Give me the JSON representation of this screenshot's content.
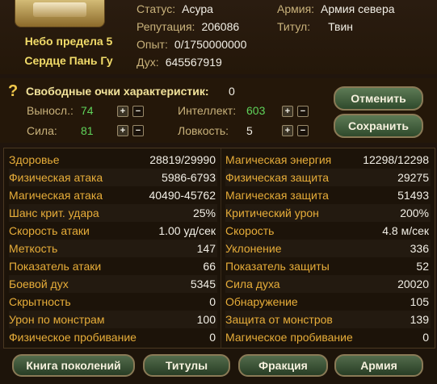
{
  "header": {
    "character_lines": [
      "Небо предела 5",
      "Сердце Пань Гу"
    ],
    "info_left": [
      {
        "label": "Статус:",
        "value": "Асура"
      },
      {
        "label": "Репутация:",
        "value": "206086"
      },
      {
        "label": "Опыт:",
        "value": "0/1750000000"
      },
      {
        "label": "Дух:",
        "value": "645567919"
      }
    ],
    "info_right": [
      {
        "label": "Армия:",
        "value": "Армия севера"
      },
      {
        "label": "Титул:",
        "value": "Твин"
      }
    ]
  },
  "points": {
    "title": "Свободные очки характеристик:",
    "free_points": "0",
    "attributes": [
      {
        "label": "Выносл.:",
        "value": "74"
      },
      {
        "label": "Интеллект:",
        "value": "603"
      },
      {
        "label": "Сила:",
        "value": "81"
      },
      {
        "label": "Ловкость:",
        "value": "5"
      }
    ],
    "plus_glyph": "+",
    "minus_glyph": "−",
    "buttons": {
      "cancel": "Отменить",
      "save": "Сохранить"
    }
  },
  "stats": {
    "left": [
      {
        "name": "Здоровье",
        "value": "28819/29990"
      },
      {
        "name": "Физическая атака",
        "value": "5986-6793"
      },
      {
        "name": "Магическая атака",
        "value": "40490-45762"
      },
      {
        "name": "Шанс крит. удара",
        "value": "25%"
      },
      {
        "name": "Скорость атаки",
        "value": "1.00 уд/сек"
      },
      {
        "name": "Меткость",
        "value": "147"
      },
      {
        "name": "Показатель атаки",
        "value": "66"
      },
      {
        "name": "Боевой дух",
        "value": "5345"
      },
      {
        "name": "Скрытность",
        "value": "0"
      },
      {
        "name": "Урон по монстрам",
        "value": "100"
      },
      {
        "name": "Физическое пробивание",
        "value": "0"
      }
    ],
    "right": [
      {
        "name": "Магическая энергия",
        "value": "12298/12298"
      },
      {
        "name": "Физическая защита",
        "value": "29275"
      },
      {
        "name": "Магическая защита",
        "value": "51493"
      },
      {
        "name": "Критический урон",
        "value": "200%"
      },
      {
        "name": "Скорость",
        "value": "4.8 м/сек"
      },
      {
        "name": "Уклонение",
        "value": "336"
      },
      {
        "name": "Показатель защиты",
        "value": "52"
      },
      {
        "name": "Сила духа",
        "value": "20020"
      },
      {
        "name": "Обнаружение",
        "value": "105"
      },
      {
        "name": "Защита от монстров",
        "value": "139"
      },
      {
        "name": "Магическое пробивание",
        "value": "0"
      }
    ]
  },
  "tabs": [
    "Книга поколений",
    "Титулы",
    "Фракция",
    "Армия"
  ],
  "icons": {
    "help": "question-mark-icon",
    "portrait": "character-portrait-icon"
  },
  "colors": {
    "stat_name": "#e7ad39",
    "attribute_value": "#5fd35a",
    "char_name": "#f2dc6a"
  }
}
